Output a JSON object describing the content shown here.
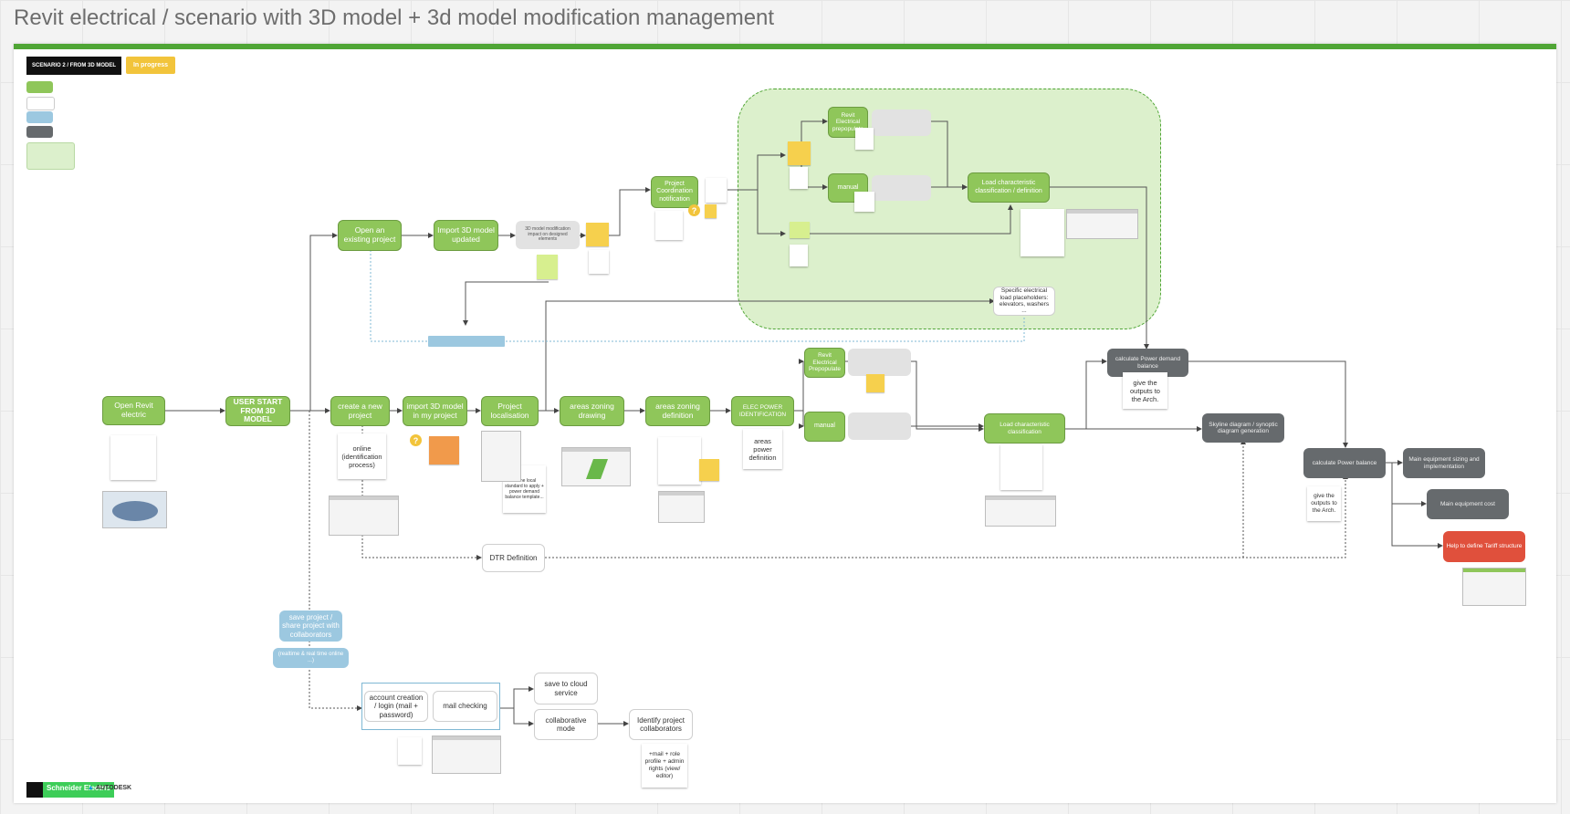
{
  "board": {
    "title": "Revit electrical / scenario with 3D model + 3d model modification management",
    "accent": "#4fa535"
  },
  "tags": {
    "scenario": "SCENARIO 2 / FROM 3D MODEL",
    "status": "In progress"
  },
  "nodes": {
    "open_revit": "Open Revit electric",
    "user_start": "USER START FROM 3D MODEL",
    "open_existing": "Open an existing project",
    "import_updated": "Import 3D model updated",
    "create_project": "create a new project",
    "import_model": "import 3D model in my project",
    "project_localisation": "Project localisation",
    "areas_drawing": "areas zoning drawing",
    "areas_definition": "areas zoning definition",
    "elec_power": "ELEC POWER IDENTIFICATION",
    "project_coordination": "Project Coordination notification",
    "revit_prepopulate_top": "Revit Electrical prepopulate",
    "manual_top": "manual",
    "load_char_top": "Load characteristic classification / definition",
    "specific_loads": "Specific electrical load placeholders: elevators, washers ...",
    "revit_prepopulate_mid": "Revit Electrical Prepopulate",
    "manual_mid": "manual",
    "load_char_mid": "Load characteristic classification",
    "calc_demand": "calculate Power demand balance",
    "give_outputs_1": "give the outputs to the Arch.",
    "skyline": "Skyline diagram / synoptic diagram generation",
    "calc_balance": "calculate Power balance",
    "give_outputs_2": "give the outputs to the Arch.",
    "main_sizing": "Main equipment sizing and implementation",
    "main_cost": "Main equipment cost",
    "help_tariff": "Help to define Tariff structure",
    "dtr": "DTR Definition",
    "save_share": "save project / share project with collaborators",
    "online_realtime": "(realtime & real time online ...)",
    "account": "account creation / login (mail + password)",
    "mail": "mail checking",
    "save_cloud": "save to cloud service",
    "collab_mode": "collaborative mode",
    "identify_collab": "Identify project collaborators"
  },
  "notes": {
    "online": "online (identification process)",
    "areas_power": "areas power definition",
    "email_roles": "+mail + role profile + admin rights (view/ editor)",
    "define_local": "define local standard to apply + power demand balance template...",
    "grey_note": "3D model modification impact on designed elements"
  },
  "logos": {
    "schneider": "Schneider Electric",
    "autodesk": "AUTODESK"
  }
}
